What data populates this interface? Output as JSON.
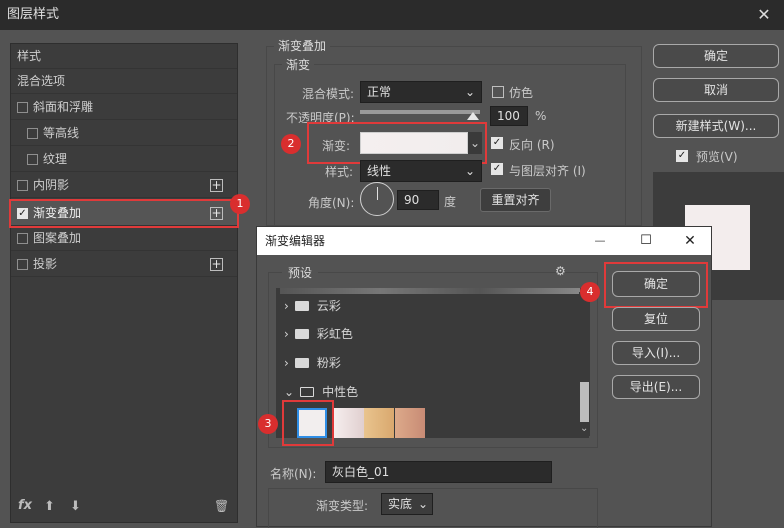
{
  "window": {
    "title": "图层样式",
    "close_icon": "✕"
  },
  "sidebar": {
    "header": "样式",
    "items": [
      {
        "label": "混合选项",
        "checkbox": false,
        "plus": false
      },
      {
        "label": "斜面和浮雕",
        "checkbox": true,
        "checked": false,
        "plus": false
      },
      {
        "label": "等高线",
        "checkbox": true,
        "checked": false,
        "plus": false,
        "indent": true
      },
      {
        "label": "纹理",
        "checkbox": true,
        "checked": false,
        "plus": false,
        "indent": true
      },
      {
        "label": "内阴影",
        "checkbox": true,
        "checked": false,
        "plus": true
      },
      {
        "label": "渐变叠加",
        "checkbox": true,
        "checked": true,
        "plus": true,
        "active": true
      },
      {
        "label": "图案叠加",
        "checkbox": true,
        "checked": false,
        "plus": false
      },
      {
        "label": "投影",
        "checkbox": true,
        "checked": false,
        "plus": true
      }
    ],
    "footer": {
      "fx": "fx",
      "up": "⬆",
      "down": "⬇",
      "trash": "🗑"
    }
  },
  "gradient_overlay": {
    "section_title": "渐变叠加",
    "subsection_title": "渐变",
    "blend_mode_label": "混合模式:",
    "blend_mode_value": "正常",
    "dither_label": "仿色",
    "opacity_label": "不透明度(P):",
    "opacity_value": "100",
    "opacity_unit": "%",
    "opacity_level": 1.0,
    "gradient_label": "渐变:",
    "reverse_label": "反向 (R)",
    "style_label": "样式:",
    "style_value": "线性",
    "align_label": "与图层对齐 (I)",
    "angle_label": "角度(N):",
    "angle_value": "90",
    "angle_unit": "度",
    "reset_align_button": "重置对齐"
  },
  "right_buttons": {
    "ok": "确定",
    "cancel": "取消",
    "new_style": "新建样式(W)...",
    "preview_label": "预览(V)"
  },
  "gradient_editor": {
    "title": "渐变编辑器",
    "minimize_icon": "—",
    "maximize_icon": "☐",
    "close_icon": "✕",
    "presets_label": "预设",
    "gear_icon": "⚙",
    "folders": [
      {
        "name": "云彩",
        "open": false
      },
      {
        "name": "彩虹色",
        "open": false
      },
      {
        "name": "粉彩",
        "open": false
      },
      {
        "name": "中性色",
        "open": true
      }
    ],
    "buttons": {
      "ok": "确定",
      "reset": "复位",
      "import": "导入(I)...",
      "export": "导出(E)..."
    },
    "name_label": "名称(N):",
    "name_value": "灰白色_01",
    "type_label": "渐变类型:",
    "type_value": "实底"
  },
  "markers": {
    "m1": "1",
    "m2": "2",
    "m3": "3",
    "m4": "4"
  },
  "colors": {
    "accent_red": "#e03a3a",
    "selection_blue": "#2f8ee6"
  }
}
